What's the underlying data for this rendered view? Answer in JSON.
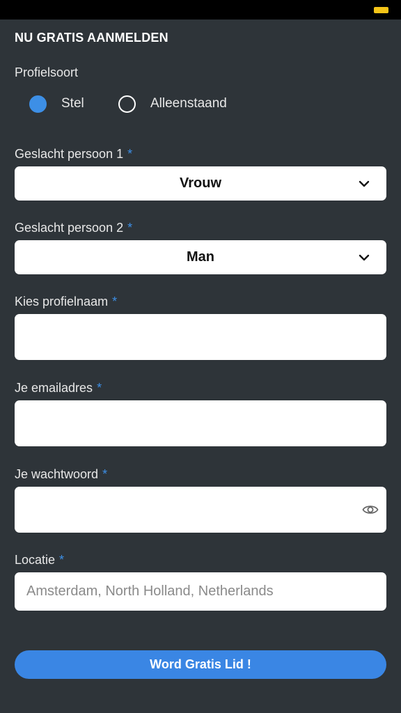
{
  "form": {
    "title": "NU GRATIS AANMELDEN",
    "profile_type": {
      "label": "Profielsoort",
      "options": [
        {
          "label": "Stel",
          "checked": true
        },
        {
          "label": "Alleenstaand",
          "checked": false
        }
      ]
    },
    "gender1": {
      "label": "Geslacht persoon 1",
      "required_mark": "*",
      "value": "Vrouw"
    },
    "gender2": {
      "label": "Geslacht persoon 2",
      "required_mark": "*",
      "value": "Man"
    },
    "profile_name": {
      "label": "Kies profielnaam",
      "required_mark": "*",
      "value": "",
      "placeholder": ""
    },
    "email": {
      "label": "Je emailadres",
      "required_mark": "*",
      "value": "",
      "placeholder": ""
    },
    "password": {
      "label": "Je wachtwoord",
      "required_mark": "*",
      "value": "",
      "placeholder": ""
    },
    "location": {
      "label": "Locatie",
      "required_mark": "*",
      "value": "",
      "placeholder": "Amsterdam, North Holland, Netherlands"
    },
    "submit_label": "Word Gratis Lid !"
  },
  "icons": {
    "chevron": "chevron-down-icon",
    "eye": "eye-icon",
    "battery": "battery-icon"
  },
  "colors": {
    "background": "#2e3439",
    "accent": "#3d8fe6",
    "button": "#3a86e4",
    "status_bar": "#000000",
    "battery": "#f5c518"
  }
}
